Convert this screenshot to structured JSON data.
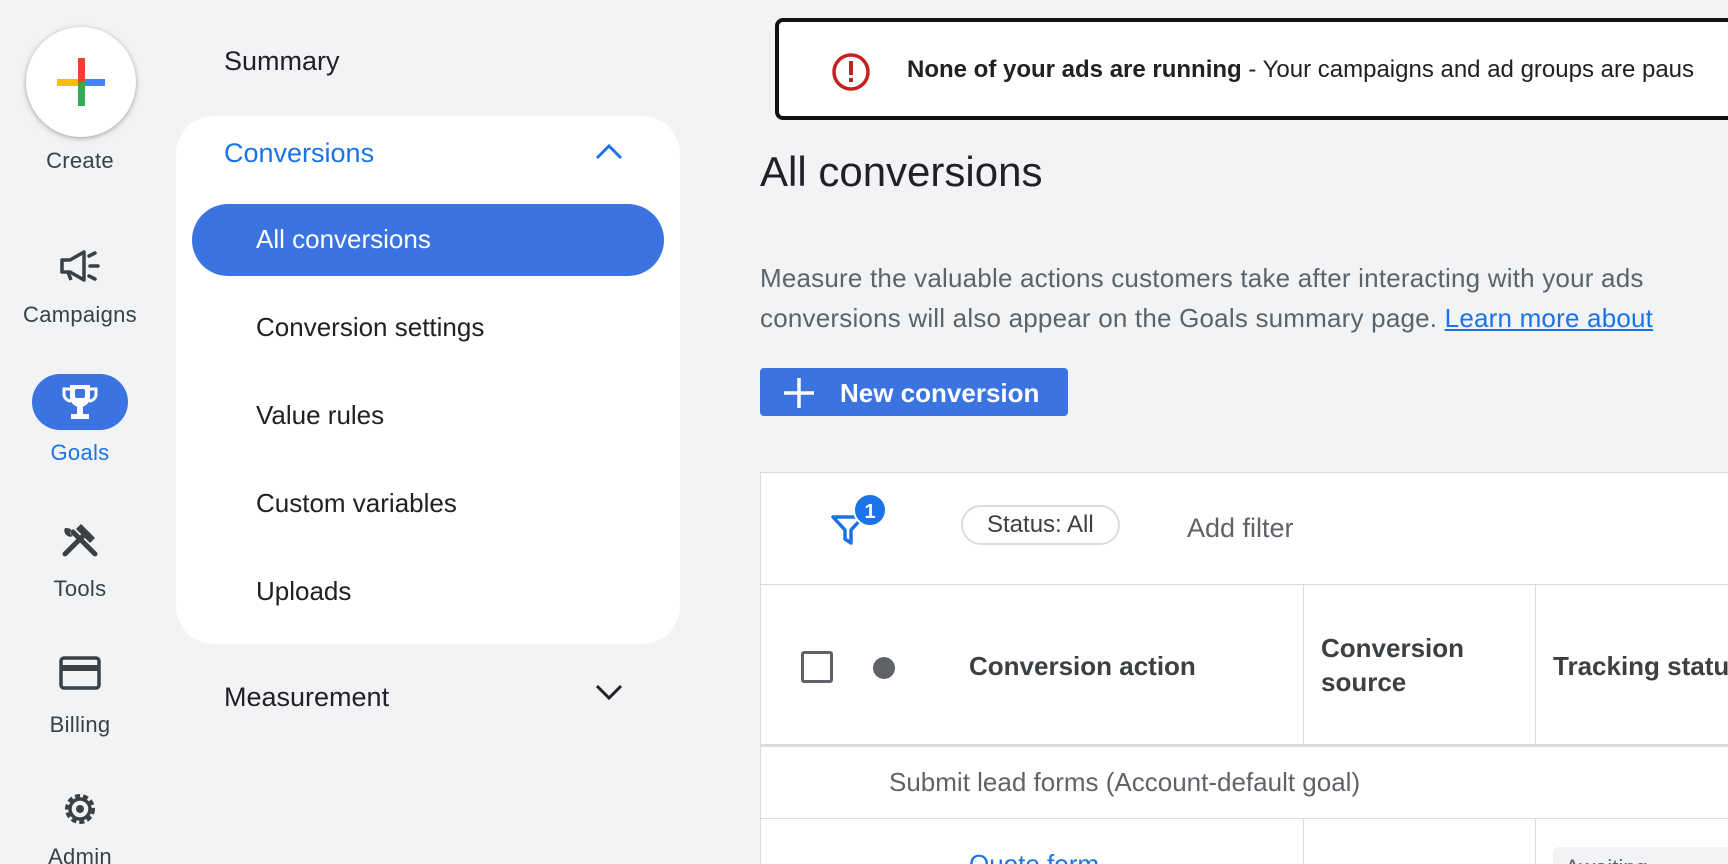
{
  "rail": {
    "create_label": "Create",
    "items": [
      {
        "label": "Campaigns",
        "icon": "megaphone-icon"
      },
      {
        "label": "Goals",
        "icon": "trophy-icon",
        "active": true
      },
      {
        "label": "Tools",
        "icon": "tools-icon"
      },
      {
        "label": "Billing",
        "icon": "credit-card-icon"
      },
      {
        "label": "Admin",
        "icon": "gear-icon"
      }
    ]
  },
  "subnav": {
    "summary": "Summary",
    "section_title": "Conversions",
    "items": [
      {
        "label": "All conversions",
        "active": true
      },
      {
        "label": "Conversion settings"
      },
      {
        "label": "Value rules"
      },
      {
        "label": "Custom variables"
      },
      {
        "label": "Uploads"
      }
    ],
    "measurement": "Measurement"
  },
  "alert": {
    "bold": "None of your ads are running",
    "rest": " - Your campaigns and ad groups are paus"
  },
  "main": {
    "title": "All conversions",
    "desc_line1": "Measure the valuable actions customers take after interacting with your ads",
    "desc_line2": "conversions will also appear on the Goals summary page. ",
    "desc_link": "Learn more about",
    "new_button": "New conversion"
  },
  "table": {
    "filter_count": "1",
    "status_chip": "Status: All",
    "add_filter": "Add filter",
    "columns": [
      "Conversion action",
      "Conversion source",
      "Tracking status"
    ],
    "col2_line1": "Conversion",
    "col2_line2": "source",
    "col3_visible": "Tracking statu",
    "group_label": "Submit lead forms (Account-default goal)",
    "first_row_action": "Quote form",
    "first_row_status": "Awaiting"
  },
  "colors": {
    "accent": "#3b73e0",
    "link": "#1a73e8",
    "alert_icon": "#c5221f"
  }
}
